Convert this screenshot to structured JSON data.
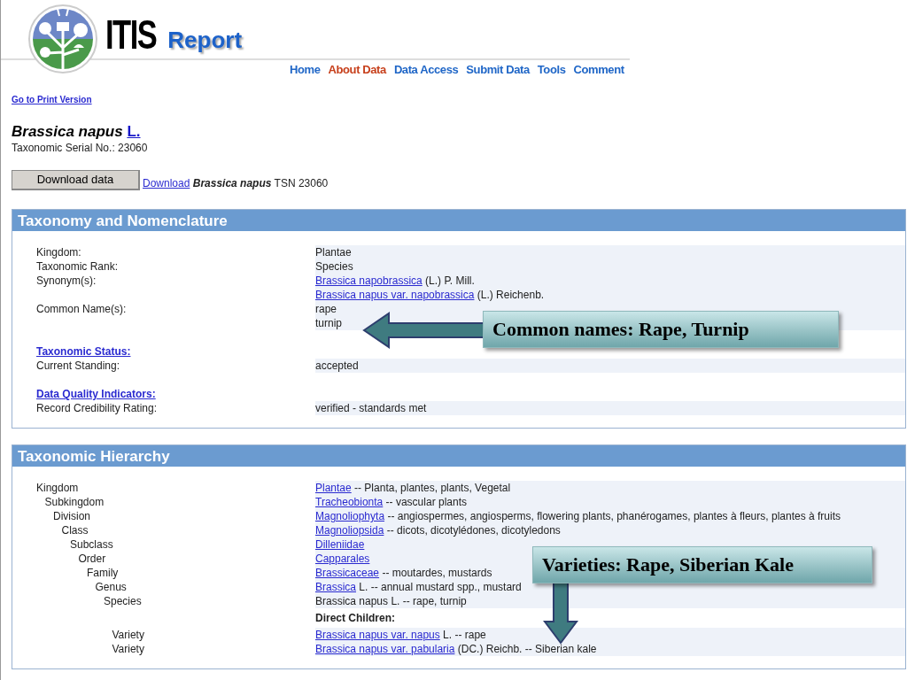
{
  "header": {
    "logo_text": "ITIS",
    "subtitle": "Report"
  },
  "nav": [
    {
      "label": "Home",
      "selected": false
    },
    {
      "label": "About Data",
      "selected": true
    },
    {
      "label": "Data Access",
      "selected": false
    },
    {
      "label": "Submit Data",
      "selected": false
    },
    {
      "label": "Tools",
      "selected": false
    },
    {
      "label": "Comment",
      "selected": false
    }
  ],
  "print_link": "Go to Print Version",
  "title": {
    "name": "Brassica napus",
    "author_link": "L."
  },
  "tsn": "Taxonomic Serial No.: 23060",
  "download": {
    "button": "Download data",
    "link": "Download",
    "name": "Brassica napus",
    "rest": "TSN 23060"
  },
  "nomenclature": {
    "title": "Taxonomy and Nomenclature",
    "groups": [
      {
        "rows": [
          {
            "label": "Kingdom:",
            "values": [
              {
                "text": "Plantae"
              }
            ]
          },
          {
            "label": "Taxonomic Rank:",
            "values": [
              {
                "text": "Species"
              }
            ]
          },
          {
            "label": "Synonym(s):",
            "values": [
              {
                "link": "Brassica napobrassica",
                "text": "(L.) P. Mill."
              },
              {
                "link": "Brassica napus var. napobrassica",
                "text": "(L.) Reichenb."
              }
            ]
          },
          {
            "label": "Common Name(s):",
            "values": [
              {
                "text": "rape"
              },
              {
                "text": "turnip"
              }
            ]
          }
        ]
      },
      {
        "heading": "Taxonomic Status:",
        "rows": [
          {
            "label": "Current Standing:",
            "values": [
              {
                "text": "accepted"
              }
            ]
          }
        ]
      },
      {
        "heading": "Data Quality Indicators:",
        "rows": [
          {
            "label": "Record Credibility Rating:",
            "values": [
              {
                "text": "verified - standards met"
              }
            ]
          }
        ]
      }
    ]
  },
  "hierarchy": {
    "title": "Taxonomic Hierarchy",
    "tree": [
      {
        "rank": "Kingdom",
        "link": "Plantae",
        "text": " -- Planta, plantes, plants, Vegetal",
        "children": [
          {
            "rank": "Subkingdom",
            "link": "Tracheobionta",
            "text": " -- vascular plants",
            "children": [
              {
                "rank": "Division",
                "link": "Magnoliophyta",
                "text": " -- angiospermes, angiosperms, flowering plants, phanérogames, plantes à fleurs, plantes à fruits",
                "children": [
                  {
                    "rank": "Class",
                    "link": "Magnoliopsida",
                    "text": " -- dicots, dicotylédones, dicotyledons",
                    "children": [
                      {
                        "rank": "Subclass",
                        "link": "Dilleniidae",
                        "children": [
                          {
                            "rank": "Order",
                            "link": "Capparales",
                            "children": [
                              {
                                "rank": "Family",
                                "link": "Brassicaceae",
                                "text": " -- moutardes, mustards",
                                "children": [
                                  {
                                    "rank": "Genus",
                                    "link": "Brassica",
                                    "text": "L. -- annual mustard spp., mustard",
                                    "children": [
                                      {
                                        "rank": "Species",
                                        "text": "Brassica napus L. -- rape, turnip"
                                      }
                                    ]
                                  }
                                ]
                              }
                            ]
                          }
                        ]
                      }
                    ]
                  }
                ]
              }
            ]
          }
        ]
      }
    ],
    "children_heading": "Direct Children:",
    "direct_children": [
      {
        "rank": "Variety",
        "link": "Brassica napus var. napus",
        "text": "L. -- rape"
      },
      {
        "rank": "Variety",
        "link": "Brassica napus var. pabularia",
        "text": "(DC.) Reichb. -- Siberian kale"
      }
    ]
  },
  "callouts": [
    {
      "text": "Common names: Rape, Turnip",
      "kind": "left"
    },
    {
      "text": "Varieties: Rape, Siberian Kale",
      "kind": "down"
    }
  ]
}
